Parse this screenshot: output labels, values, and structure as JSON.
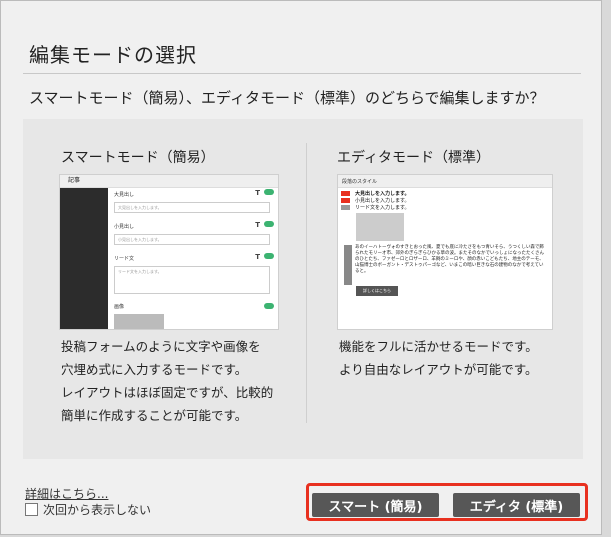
{
  "dialog": {
    "title": "編集モードの選択",
    "question": "スマートモード（簡易）、エディタモード（標準）のどちらで編集しますか？"
  },
  "smart": {
    "title": "スマートモード（簡易）",
    "description": [
      "投稿フォームのように文字や画像を",
      "穴埋め式に入力するモードです。",
      "レイアウトはほぼ固定ですが、比較的",
      "簡単に作成することが可能です。"
    ],
    "preview": {
      "header": "記事",
      "fields": [
        {
          "label": "大見出し",
          "placeholder": "大見出しを入力します。"
        },
        {
          "label": "小見出し",
          "placeholder": "小見出しを入力します。"
        },
        {
          "label": "リード文",
          "placeholder": "リード文を入力します。"
        },
        {
          "label": "画像",
          "placeholder": ""
        }
      ]
    }
  },
  "editor": {
    "title": "エディタモード（標準）",
    "description": [
      "機能をフルに活かせるモードです。",
      "より自由なレイアウトが可能です。"
    ],
    "preview": {
      "toolbar": "段落のスタイル",
      "heading1": "大見出しを入力します。",
      "heading2": "小見出しを入力します。",
      "lead": "リード文を入力します。",
      "body": "あのイーハトーヴォのすきとおった風、夏でも底に冷たさをもつ青いそら、うつくしい森で飾られたモリーオ市、郊外のぎらぎらひかる草の波。またそのなかでいっしょになったたくさんのひとたち、ファゼーロとロザーロ、羊飼のミーロや、顔の赤いこどもたち、地主のテーモ、山猫博士のボーガント・デストゥパーゴなど、いまこの暗い巨きな石の建物のなかで考えていると。",
      "button": "詳しくはこちら"
    }
  },
  "footer": {
    "details_link": "詳細はこちら...",
    "dont_show_label": "次回から表示しない",
    "smart_button": "スマート (簡易)",
    "editor_button": "エディタ (標準)"
  },
  "colors": {
    "highlight": "#e8301f",
    "button_bg": "#575757",
    "toggle": "#3cb371"
  }
}
